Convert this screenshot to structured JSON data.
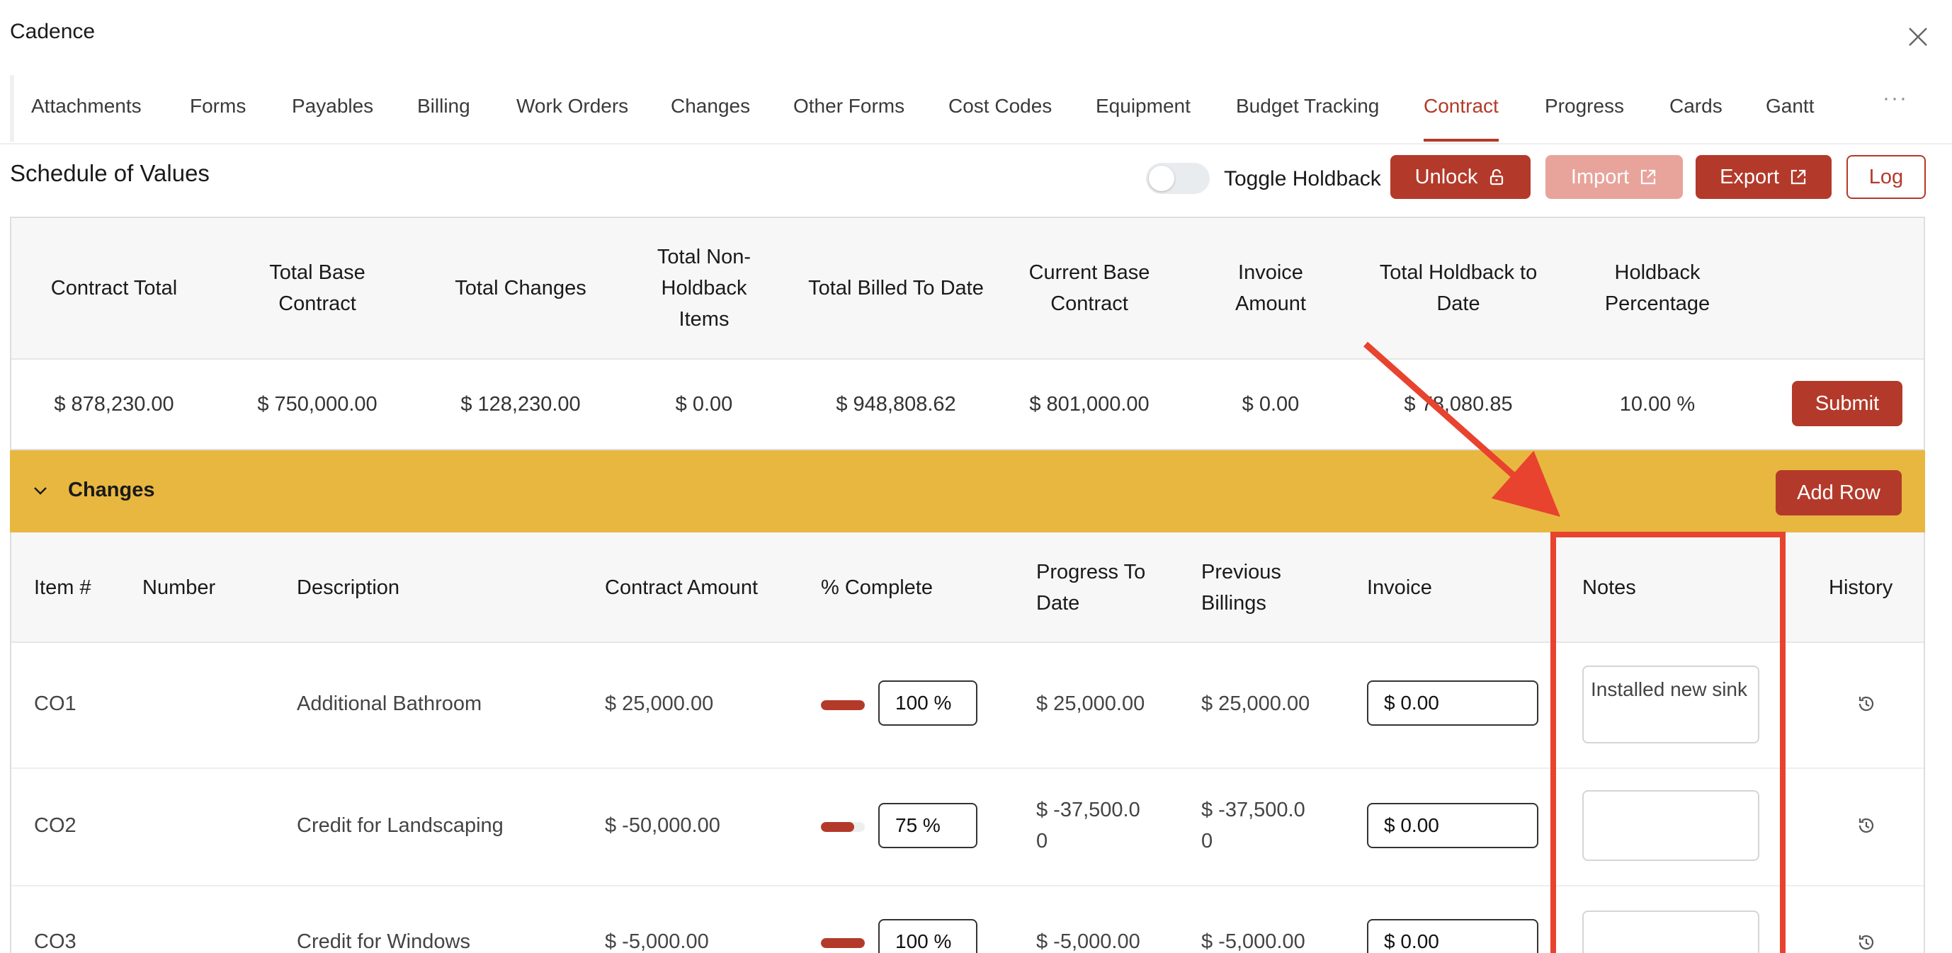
{
  "app": {
    "title": "Cadence"
  },
  "tabs": [
    {
      "label": "Attachments"
    },
    {
      "label": "Forms"
    },
    {
      "label": "Payables"
    },
    {
      "label": "Billing"
    },
    {
      "label": "Work Orders"
    },
    {
      "label": "Changes"
    },
    {
      "label": "Other Forms"
    },
    {
      "label": "Cost Codes"
    },
    {
      "label": "Equipment"
    },
    {
      "label": "Budget Tracking"
    },
    {
      "label": "Contract",
      "active": true
    },
    {
      "label": "Progress"
    },
    {
      "label": "Cards"
    },
    {
      "label": "Gantt"
    }
  ],
  "more_tabs": "···",
  "schedule": {
    "title": "Schedule of Values",
    "toggle_label": "Toggle Holdback",
    "toggle_on": false,
    "buttons": {
      "unlock": "Unlock",
      "import": "Import",
      "export": "Export",
      "log": "Log"
    }
  },
  "summary": {
    "headers": {
      "contract_total": "Contract Total",
      "total_base_contract": "Total Base Contract",
      "total_changes": "Total Changes",
      "total_non_holdback": "Total Non-Holdback Items",
      "total_billed": "Total Billed To Date",
      "current_base": "Current Base Contract",
      "invoice_amount": "Invoice Amount",
      "total_holdback": "Total Holdback to Date",
      "holdback_pct": "Holdback Percentage"
    },
    "values": {
      "contract_total": "$ 878,230.00",
      "total_base_contract": "$ 750,000.00",
      "total_changes": "$ 128,230.00",
      "total_non_holdback": "$ 0.00",
      "total_billed": "$ 948,808.62",
      "current_base": "$ 801,000.00",
      "invoice_amount": "$ 0.00",
      "total_holdback": "$ 78,080.85",
      "holdback_pct": "10.00 %"
    },
    "submit_label": "Submit"
  },
  "changes": {
    "title": "Changes",
    "add_row_label": "Add Row",
    "headers": {
      "item": "Item #",
      "number": "Number",
      "description": "Description",
      "contract_amount": "Contract Amount",
      "pct_complete": "% Complete",
      "progress_to_date": "Progress To Date",
      "previous_billings": "Previous Billings",
      "invoice": "Invoice",
      "notes": "Notes",
      "history": "History"
    },
    "rows": [
      {
        "item": "CO1",
        "number": "",
        "description": "Additional Bathroom",
        "contract_amount": "$ 25,000.00",
        "progress": 1.0,
        "pct": "100 %",
        "progress_to_date": "$ 25,000.00",
        "previous_billings": "$ 25,000.00",
        "invoice": "$ 0.00",
        "notes": "Installed new sink"
      },
      {
        "item": "CO2",
        "number": "",
        "description": "Credit for Landscaping",
        "contract_amount": "$ -50,000.00",
        "progress": 0.75,
        "pct": "75 %",
        "progress_to_date": "$ -37,500.00",
        "previous_billings": "$ -37,500.00",
        "invoice": "$ 0.00",
        "notes": ""
      },
      {
        "item": "CO3",
        "number": "",
        "description": "Credit for Windows",
        "contract_amount": "$ -5,000.00",
        "progress": 1.0,
        "pct": "100 %",
        "progress_to_date": "$ -5,000.00",
        "previous_billings": "$ -5,000.00",
        "invoice": "$ 0.00",
        "notes": ""
      }
    ]
  },
  "colors": {
    "accent": "#b33a2a",
    "changes_bar": "#e8b740",
    "annotation": "#e8432e"
  },
  "icons": {
    "close": "close-icon",
    "lock": "unlock-icon",
    "external": "external-link-icon",
    "chevron": "chevron-down-icon",
    "history": "history-icon"
  }
}
